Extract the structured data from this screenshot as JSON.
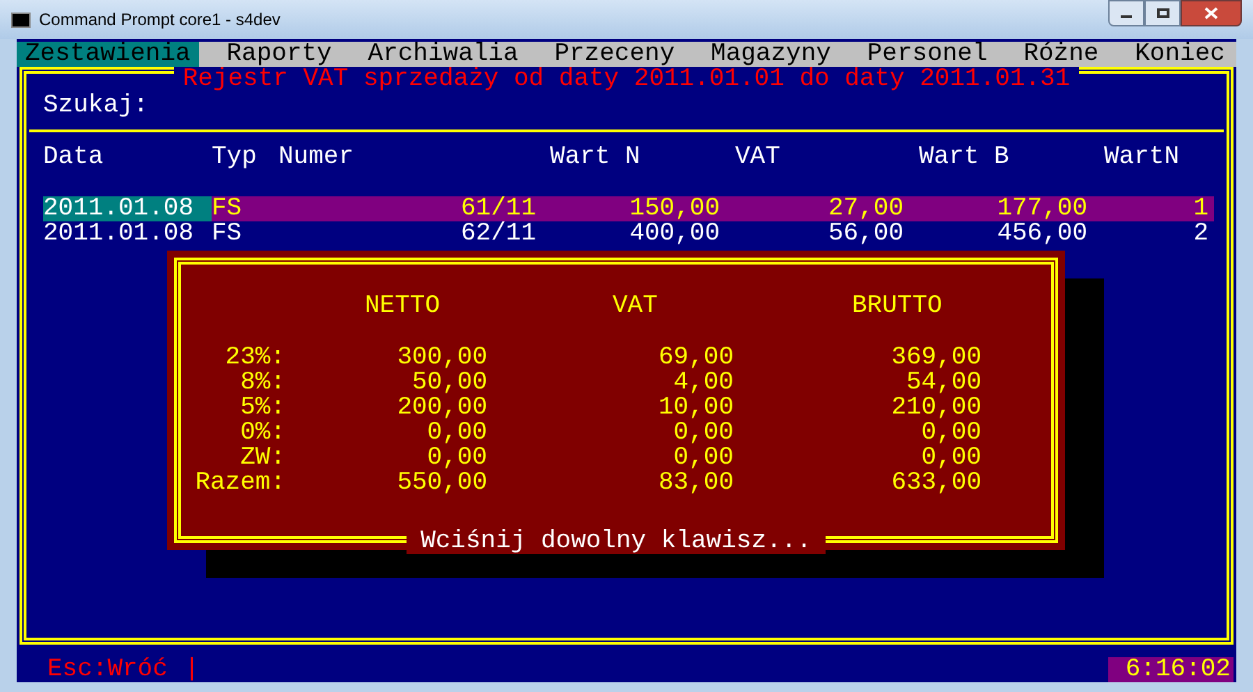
{
  "window": {
    "title": "Command Prompt  core1 - s4dev"
  },
  "menu": [
    {
      "label": "Zestawienia",
      "selected": true
    },
    {
      "label": "Raporty",
      "selected": false
    },
    {
      "label": "Archiwalia",
      "selected": false
    },
    {
      "label": "Przeceny",
      "selected": false
    },
    {
      "label": "Magazyny",
      "selected": false
    },
    {
      "label": "Personel",
      "selected": false
    },
    {
      "label": "Różne",
      "selected": false
    },
    {
      "label": "Koniec",
      "selected": false
    }
  ],
  "report": {
    "title": "Rejestr VAT sprzedaży od daty 2011.01.01 do daty 2011.01.31",
    "search_label": "Szukaj:",
    "columns": [
      "Data",
      "Typ",
      "Numer",
      "Wart N",
      "VAT",
      "Wart B",
      "WartN"
    ],
    "rows": [
      {
        "selected": true,
        "cells": [
          "2011.01.08",
          "FS",
          "61/11",
          "150,00",
          "27,00",
          "177,00",
          "1"
        ]
      },
      {
        "selected": false,
        "cells": [
          "2011.01.08",
          "FS",
          "62/11",
          "400,00",
          "56,00",
          "456,00",
          "2"
        ]
      }
    ]
  },
  "dialog": {
    "headers": [
      "NETTO",
      "VAT",
      "BRUTTO"
    ],
    "rows": [
      {
        "label": "23%:",
        "values": [
          "300,00",
          "69,00",
          "369,00"
        ]
      },
      {
        "label": "8%:",
        "values": [
          "50,00",
          "4,00",
          "54,00"
        ]
      },
      {
        "label": "5%:",
        "values": [
          "200,00",
          "10,00",
          "210,00"
        ]
      },
      {
        "label": "0%:",
        "values": [
          "0,00",
          "0,00",
          "0,00"
        ]
      },
      {
        "label": "ZW:",
        "values": [
          "0,00",
          "0,00",
          "0,00"
        ]
      },
      {
        "label": "Razem:",
        "values": [
          "550,00",
          "83,00",
          "633,00"
        ]
      }
    ],
    "footer": "Wciśnij dowolny klawisz..."
  },
  "status_bar": {
    "hint": "Esc:Wróć",
    "separator": "|",
    "time": "6:16:02"
  }
}
